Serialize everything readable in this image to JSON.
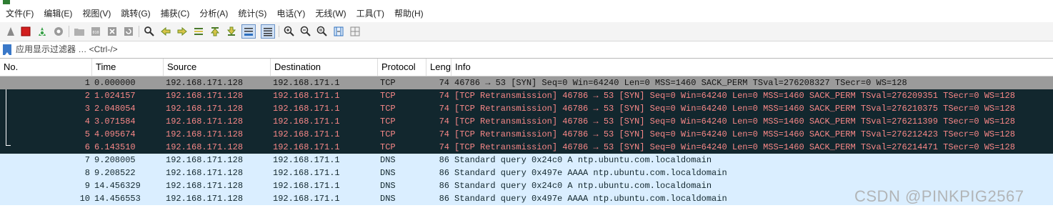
{
  "menu": [
    "文件(F)",
    "编辑(E)",
    "视图(V)",
    "跳转(G)",
    "捕获(C)",
    "分析(A)",
    "统计(S)",
    "电话(Y)",
    "无线(W)",
    "工具(T)",
    "帮助(H)"
  ],
  "filter": {
    "placeholder": "应用显示过滤器 … <Ctrl-/>"
  },
  "columns": [
    "No.",
    "Time",
    "Source",
    "Destination",
    "Protocol",
    "Leng",
    "Info"
  ],
  "packets": [
    {
      "no": "1",
      "time": "0.000000",
      "src": "192.168.171.128",
      "dst": "192.168.171.1",
      "proto": "TCP",
      "len": "74",
      "info": "46786 → 53 [SYN] Seq=0 Win=64240 Len=0 MSS=1460 SACK_PERM TSval=276208327 TSecr=0 WS=128"
    },
    {
      "no": "2",
      "time": "1.024157",
      "src": "192.168.171.128",
      "dst": "192.168.171.1",
      "proto": "TCP",
      "len": "74",
      "info": "[TCP Retransmission] 46786 → 53 [SYN] Seq=0 Win=64240 Len=0 MSS=1460 SACK_PERM TSval=276209351 TSecr=0 WS=128"
    },
    {
      "no": "3",
      "time": "2.048054",
      "src": "192.168.171.128",
      "dst": "192.168.171.1",
      "proto": "TCP",
      "len": "74",
      "info": "[TCP Retransmission] 46786 → 53 [SYN] Seq=0 Win=64240 Len=0 MSS=1460 SACK_PERM TSval=276210375 TSecr=0 WS=128"
    },
    {
      "no": "4",
      "time": "3.071584",
      "src": "192.168.171.128",
      "dst": "192.168.171.1",
      "proto": "TCP",
      "len": "74",
      "info": "[TCP Retransmission] 46786 → 53 [SYN] Seq=0 Win=64240 Len=0 MSS=1460 SACK_PERM TSval=276211399 TSecr=0 WS=128"
    },
    {
      "no": "5",
      "time": "4.095674",
      "src": "192.168.171.128",
      "dst": "192.168.171.1",
      "proto": "TCP",
      "len": "74",
      "info": "[TCP Retransmission] 46786 → 53 [SYN] Seq=0 Win=64240 Len=0 MSS=1460 SACK_PERM TSval=276212423 TSecr=0 WS=128"
    },
    {
      "no": "6",
      "time": "6.143510",
      "src": "192.168.171.128",
      "dst": "192.168.171.1",
      "proto": "TCP",
      "len": "74",
      "info": "[TCP Retransmission] 46786 → 53 [SYN] Seq=0 Win=64240 Len=0 MSS=1460 SACK_PERM TSval=276214471 TSecr=0 WS=128"
    },
    {
      "no": "7",
      "time": "9.208005",
      "src": "192.168.171.128",
      "dst": "192.168.171.1",
      "proto": "DNS",
      "len": "86",
      "info": "Standard query 0x24c0 A ntp.ubuntu.com.localdomain"
    },
    {
      "no": "8",
      "time": "9.208522",
      "src": "192.168.171.128",
      "dst": "192.168.171.1",
      "proto": "DNS",
      "len": "86",
      "info": "Standard query 0x497e AAAA ntp.ubuntu.com.localdomain"
    },
    {
      "no": "9",
      "time": "14.456329",
      "src": "192.168.171.128",
      "dst": "192.168.171.1",
      "proto": "DNS",
      "len": "86",
      "info": "Standard query 0x24c0 A ntp.ubuntu.com.localdomain"
    },
    {
      "no": "10",
      "time": "14.456553",
      "src": "192.168.171.128",
      "dst": "192.168.171.1",
      "proto": "DNS",
      "len": "86",
      "info": "Standard query 0x497e AAAA ntp.ubuntu.com.localdomain"
    }
  ],
  "row_colors": {
    "selected_bg": "#9b9b9b",
    "tcp_problem_bg": "#12272e",
    "tcp_problem_fg": "#f78787",
    "udp_bg": "#daeeff",
    "udp_fg": "#12272e"
  },
  "watermark": "CSDN @PINKPIG2567"
}
